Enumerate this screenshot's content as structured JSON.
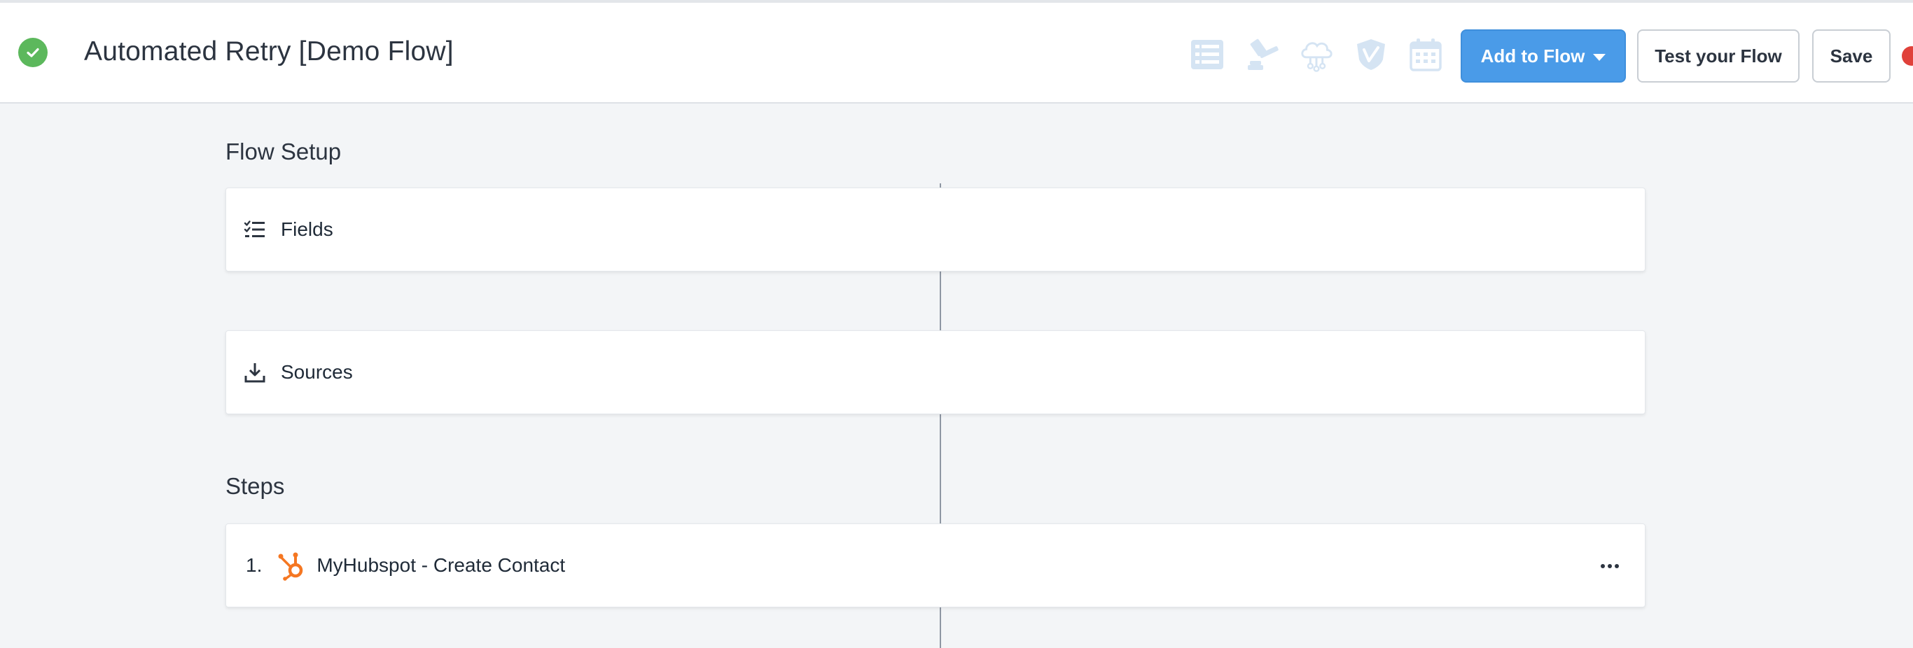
{
  "header": {
    "title": "Automated Retry [Demo Flow]",
    "status_icon": "check-circle-icon",
    "toolbar_icons": [
      "list-icon",
      "gavel-icon",
      "cloud-network-icon",
      "vimeo-shield-icon",
      "calendar-icon"
    ],
    "add_to_flow_label": "Add to Flow",
    "test_flow_label": "Test your Flow",
    "save_label": "Save",
    "accent_color": "#4a9be8"
  },
  "flow_setup": {
    "title": "Flow Setup",
    "fields_label": "Fields",
    "sources_label": "Sources"
  },
  "steps": {
    "title": "Steps",
    "items": [
      {
        "number": "1.",
        "label": "MyHubspot - Create Contact",
        "icon": "hubspot-icon"
      }
    ]
  }
}
